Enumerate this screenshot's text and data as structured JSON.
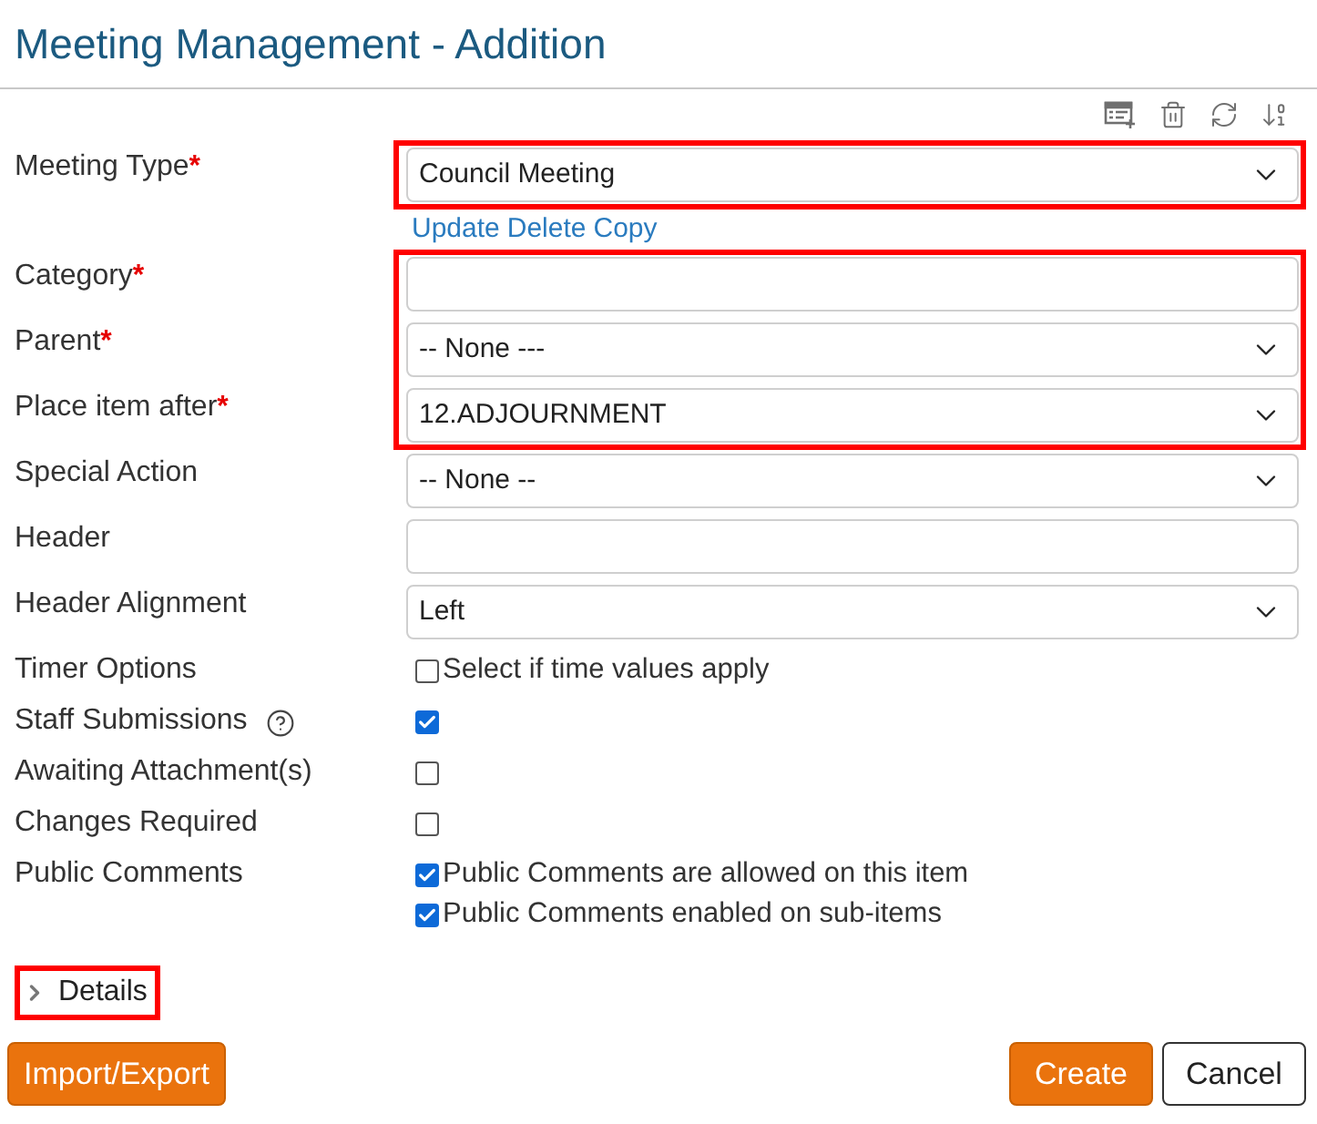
{
  "title": "Meeting Management - Addition",
  "groups": [
    {
      "highlighted": true,
      "fields": [
        {
          "kind": "select",
          "label": "Meeting Type",
          "required_mark": "*",
          "value": "Council Meeting"
        }
      ],
      "links": [
        "Update",
        "Delete",
        "Copy"
      ]
    },
    {
      "highlighted": true,
      "fields": [
        {
          "kind": "text",
          "label": "Category",
          "required_mark": "*"
        },
        {
          "kind": "select",
          "label": "Parent",
          "required_mark": "*",
          "value": "-- None ---"
        },
        {
          "kind": "select",
          "label": "Place item after",
          "required_mark": "*",
          "value": "12.ADJOURNMENT"
        }
      ]
    },
    {
      "highlighted": false,
      "fields": [
        {
          "kind": "select",
          "label": "Special Action",
          "value": "-- None --"
        },
        {
          "kind": "text",
          "label": "Header"
        },
        {
          "kind": "select",
          "label": "Header Alignment",
          "value": "Left"
        },
        {
          "kind": "checks",
          "label": "Timer Options",
          "options": [
            {
              "label": "Select if time values apply",
              "checked": false
            }
          ]
        },
        {
          "kind": "checks",
          "label": "Staff Submissions",
          "help": true,
          "options": [
            {
              "checked": true
            }
          ]
        },
        {
          "kind": "checks",
          "label": "Awaiting Attachment(s)",
          "options": [
            {
              "checked": false
            }
          ]
        },
        {
          "kind": "checks",
          "label": "Changes Required",
          "options": [
            {
              "checked": false
            }
          ]
        },
        {
          "kind": "checks",
          "label": "Public Comments",
          "options": [
            {
              "label": "Public Comments are allowed on this item",
              "checked": true
            },
            {
              "label": "Public Comments enabled on sub-items",
              "checked": true
            }
          ]
        }
      ]
    }
  ],
  "details": {
    "label": "Details",
    "expanded": false,
    "highlighted": true
  },
  "buttons": {
    "left": [
      {
        "label": "Import/Export",
        "kind": "primary"
      }
    ],
    "right": [
      {
        "label": "Create",
        "kind": "primary"
      },
      {
        "label": "Cancel",
        "kind": "secondary"
      }
    ]
  }
}
